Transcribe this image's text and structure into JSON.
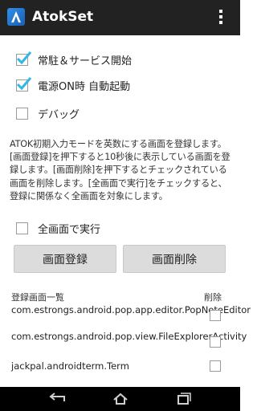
{
  "app": {
    "title": "AtokSet"
  },
  "options": [
    {
      "label": "常駐＆サービス開始",
      "checked": true
    },
    {
      "label": "電源ON時 自動起動",
      "checked": true
    },
    {
      "label": "デバッグ",
      "checked": false
    }
  ],
  "description": "ATOK初期入力モードを英数にする画面を登録します。[画面登録]を押下すると10秒後に表示している画面を登録します。[画面削除]を押下するとチェックされている画面を削除します。[全画面で実行]をチェックすると、登録に関係なく全画面を対象にします。",
  "fullscreen_option": {
    "label": "全画面で実行",
    "checked": false
  },
  "buttons": {
    "register": "画面登録",
    "delete": "画面削除"
  },
  "list": {
    "header": "登録画面一覧",
    "delete_header": "削除",
    "items": [
      {
        "name": "com.estrongs.android.pop.app.editor.PopNoteEditor",
        "checked": false
      },
      {
        "name": "com.estrongs.android.pop.view.FileExplorerActivity",
        "checked": false
      },
      {
        "name": "jackpal.androidterm.Term",
        "checked": false
      }
    ]
  },
  "colors": {
    "actionbar": "#222222",
    "check_accent": "#33b5e5"
  }
}
